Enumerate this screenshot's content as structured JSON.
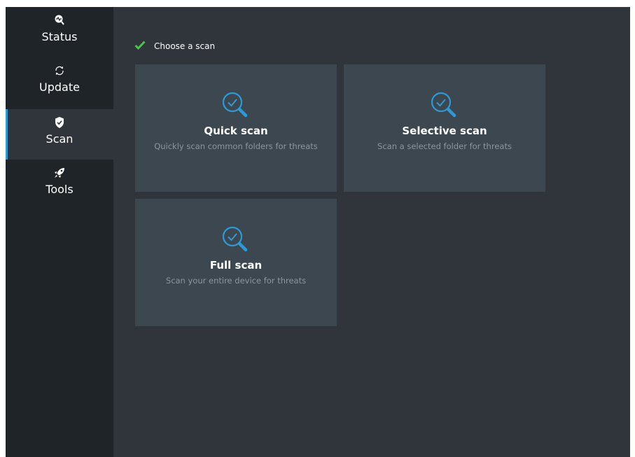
{
  "colors": {
    "sidebar_bg": "#1f2428",
    "content_bg": "#30353c",
    "card_bg": "#3d474f",
    "accent": "#2b9ad8",
    "check": "#4cc44c",
    "muted_text": "#8c969d"
  },
  "sidebar": {
    "items": [
      {
        "label": "Status",
        "icon": "status-icon",
        "active": false
      },
      {
        "label": "Update",
        "icon": "update-icon",
        "active": false
      },
      {
        "label": "Scan",
        "icon": "shield-icon",
        "active": true
      },
      {
        "label": "Tools",
        "icon": "rocket-icon",
        "active": false
      }
    ]
  },
  "main": {
    "heading": "Choose a scan",
    "heading_icon": "checkmark-icon",
    "cards": [
      {
        "title": "Quick scan",
        "description": "Quickly scan common folders for threats",
        "icon": "scan-magnifier-icon"
      },
      {
        "title": "Selective scan",
        "description": "Scan a selected folder for threats",
        "icon": "scan-magnifier-icon"
      },
      {
        "title": "Full scan",
        "description": "Scan your entire device for threats",
        "icon": "scan-magnifier-icon"
      }
    ]
  }
}
